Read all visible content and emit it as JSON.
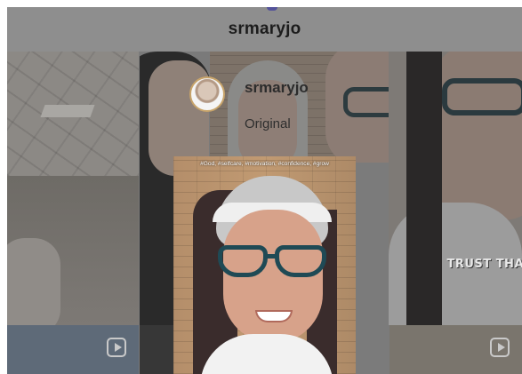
{
  "header": {
    "title": "srmaryjo"
  },
  "profile_card": {
    "username": "srmaryjo",
    "audio_label": "Original"
  },
  "video": {
    "caption": "#God, #selfcare, #motivation, #confidence, #grow"
  },
  "grid_overlay_text": "TRUST THA",
  "icons": [
    "reel-icon"
  ]
}
